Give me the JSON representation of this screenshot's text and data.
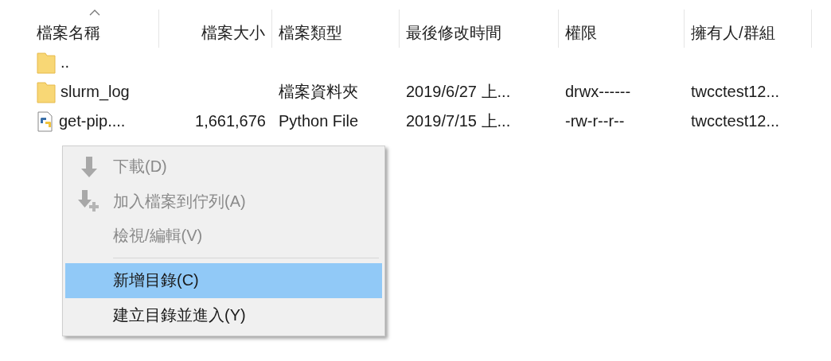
{
  "table": {
    "columns": [
      {
        "label": "檔案名稱",
        "sorted": true
      },
      {
        "label": "檔案大小",
        "sorted": false
      },
      {
        "label": "檔案類型",
        "sorted": false
      },
      {
        "label": "最後修改時間",
        "sorted": false
      },
      {
        "label": "權限",
        "sorted": false
      },
      {
        "label": "擁有人/群組",
        "sorted": false
      }
    ],
    "rows": [
      {
        "kind": "folder",
        "cells": [
          "..",
          "",
          "",
          "",
          "",
          ""
        ]
      },
      {
        "kind": "folder",
        "cells": [
          "slurm_log",
          "",
          "檔案資料夾",
          "2019/6/27 上...",
          "drwx------",
          "twcctest12..."
        ]
      },
      {
        "kind": "python",
        "cells": [
          "get-pip....",
          "1,661,676",
          "Python File",
          "2019/7/15 上...",
          "-rw-r--r--",
          "twcctest12..."
        ]
      }
    ]
  },
  "context_menu": {
    "items": [
      {
        "kind": "item",
        "label": "下載(D)",
        "disabled": true,
        "selected": false
      },
      {
        "kind": "item",
        "label": "加入檔案到佇列(A)",
        "disabled": true,
        "selected": false
      },
      {
        "kind": "item",
        "label": "檢視/編輯(V)",
        "disabled": true,
        "selected": false
      },
      {
        "kind": "separator"
      },
      {
        "kind": "item",
        "label": "新增目錄(C)",
        "disabled": false,
        "selected": true
      },
      {
        "kind": "item",
        "label": "建立目錄並進入(Y)",
        "disabled": false,
        "selected": false
      }
    ]
  }
}
